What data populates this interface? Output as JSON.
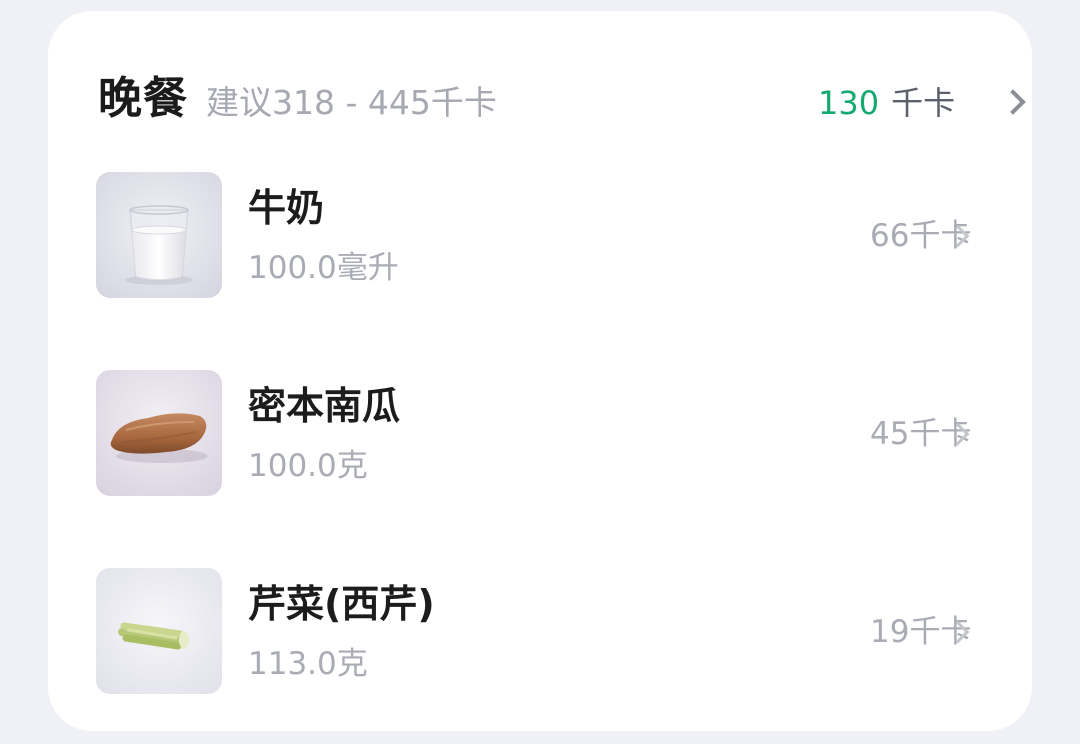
{
  "meal": {
    "title": "晚餐",
    "suggestion": "建议318 - 445千卡",
    "total_value": "130",
    "total_unit": "千卡"
  },
  "items": [
    {
      "name": "牛奶",
      "quantity": "100.0毫升",
      "calories": "66千卡",
      "icon": "milk-glass-icon"
    },
    {
      "name": "密本南瓜",
      "quantity": "100.0克",
      "calories": "45千卡",
      "icon": "pumpkin-icon"
    },
    {
      "name": "芹菜(西芹)",
      "quantity": "113.0克",
      "calories": "19千卡",
      "icon": "celery-icon"
    }
  ],
  "colors": {
    "accent_green": "#14a971",
    "card_background": "#ffffff",
    "page_background": "#f0f1f6"
  }
}
